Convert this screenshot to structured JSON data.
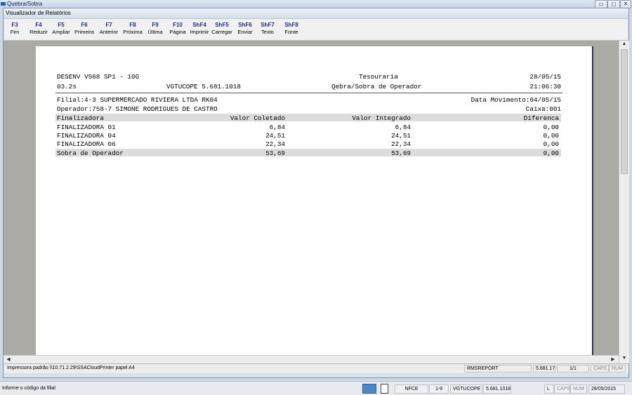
{
  "outer_window": {
    "title": "Quebra/Sobra",
    "minimize_glyph": "▭",
    "maximize_glyph": "◻",
    "close_glyph": "✕"
  },
  "inner_window": {
    "title": "Visualizador de Relatórios"
  },
  "toolbar": [
    {
      "key": "F3",
      "label": "Fim"
    },
    {
      "key": "F4",
      "label": "Reduzir"
    },
    {
      "key": "F5",
      "label": "Ampliar"
    },
    {
      "key": "F6",
      "label": "Primeira"
    },
    {
      "key": "F7",
      "label": "Anterior"
    },
    {
      "key": "F8",
      "label": "Próxima"
    },
    {
      "key": "F9",
      "label": "Última"
    },
    {
      "key": "F10",
      "label": "Página"
    },
    {
      "key": "ShF4",
      "label": "Imprimir"
    },
    {
      "key": "ShF5",
      "label": "Carregar"
    },
    {
      "key": "ShF6",
      "label": "Enviar"
    },
    {
      "key": "ShF7",
      "label": "Texto"
    },
    {
      "key": "ShF8",
      "label": "Fonte"
    }
  ],
  "report": {
    "header": {
      "system": "DESENV V568 SP1 - 10G",
      "dept": "Tesouraria",
      "date": "28/05/15",
      "code": "03.2s",
      "program": "VGTUCOPE 5.681.1018",
      "title": "Qebra/Sobra de Operador",
      "time": "21:06:30"
    },
    "filial": "Filial:4-3 SUPERMERCADO RIVIERA LTDA RK04",
    "data_movimento": "Data Movimento:04/05/15",
    "operador": "Operador:758-7 SIMONE RODRIGUES DE CASTRO",
    "caixa": "Caixa:001",
    "columns": [
      "Finalizadora",
      "Valor Coletado",
      "Valor Integrado",
      "Diferenca"
    ],
    "rows": [
      [
        "FINALIZADORA 01",
        "6,84",
        "6,84",
        "0,00"
      ],
      [
        "FINALIZADORA 04",
        "24,51",
        "24,51",
        "0,00"
      ],
      [
        "FINALIZADORA 06",
        "22,34",
        "22,34",
        "0,00"
      ]
    ],
    "total": [
      "Sobra de Operador",
      "53,69",
      "53,69",
      "0,00"
    ]
  },
  "statusbar": {
    "printer": "Impressora padrão \\\\10.71.2.29\\SSACloudPrinter papel A4",
    "report_name": "RMSREPORT",
    "version": "5.681.17",
    "pages": "1/1",
    "caps": "CAPS",
    "num": "NUM"
  },
  "bottombar": {
    "hint": "Informe o código da filial",
    "nfce": "NFCE",
    "range": "1-9",
    "program": "VGTUCOPE",
    "version": "5.681.1018",
    "l": "L",
    "caps": "CAPS",
    "num": "NUM",
    "date": "28/05/2015"
  }
}
